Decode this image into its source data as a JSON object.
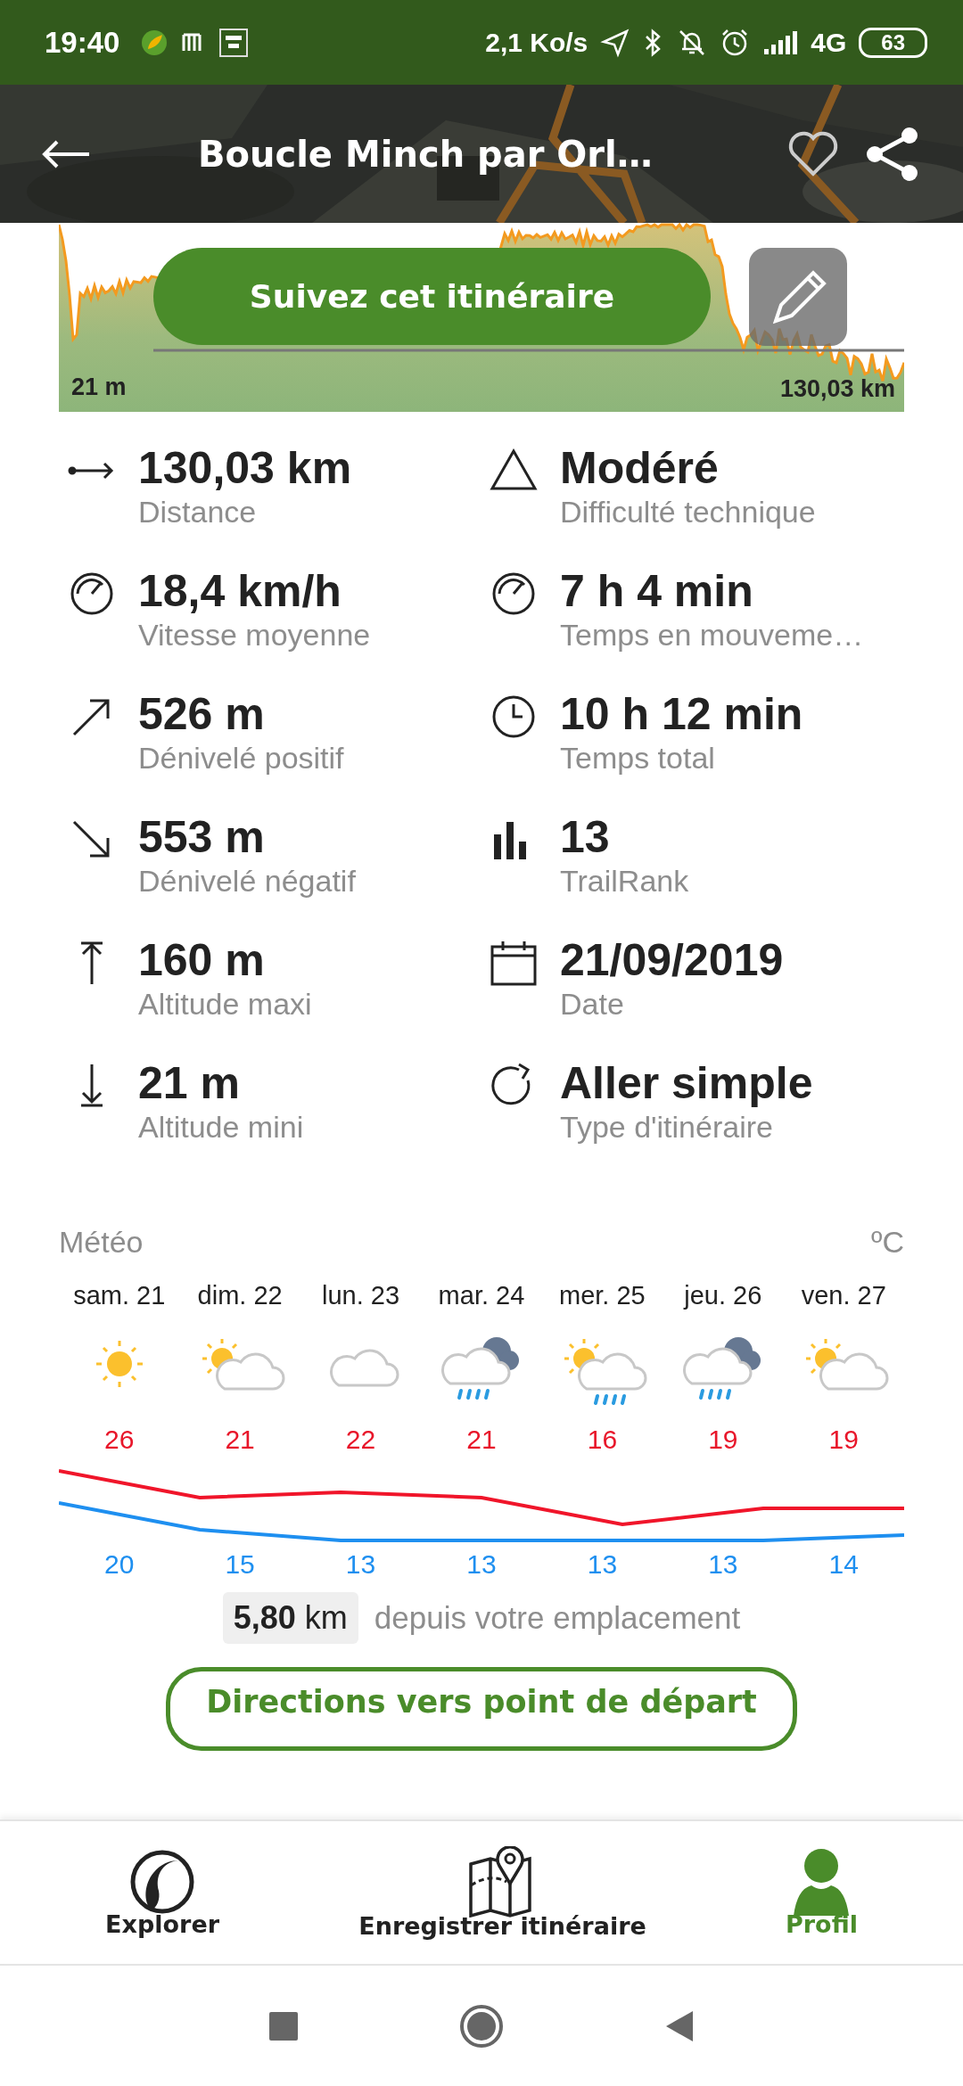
{
  "status_bar": {
    "time": "19:40",
    "speed": "2,1 Ko/s",
    "network": "4G",
    "battery": "63"
  },
  "header": {
    "title": "Boucle Minch par Orl…"
  },
  "profile": {
    "min_label": "21 m",
    "length_label": "130,03 km",
    "follow_button": "Suivez cet itinéraire"
  },
  "stats": [
    {
      "kind": "distance",
      "value": "130,03 km",
      "label": "Distance"
    },
    {
      "kind": "difficulty",
      "value": "Modéré",
      "label": "Difficulté technique"
    },
    {
      "kind": "speed",
      "value": "18,4 km/h",
      "label": "Vitesse moyenne"
    },
    {
      "kind": "moving",
      "value": "7 h 4 min",
      "label": "Temps en mouveme…"
    },
    {
      "kind": "up",
      "value": "526 m",
      "label": "Dénivelé positif"
    },
    {
      "kind": "clock",
      "value": "10 h 12 min",
      "label": "Temps total"
    },
    {
      "kind": "down",
      "value": "553 m",
      "label": "Dénivelé négatif"
    },
    {
      "kind": "rank",
      "value": "13",
      "label": "TrailRank"
    },
    {
      "kind": "max",
      "value": "160 m",
      "label": "Altitude maxi"
    },
    {
      "kind": "date",
      "value": "21/09/2019",
      "label": "Date"
    },
    {
      "kind": "min",
      "value": "21 m",
      "label": "Altitude mini"
    },
    {
      "kind": "loop",
      "value": "Aller simple",
      "label": "Type d'itinéraire"
    }
  ],
  "weather": {
    "title": "Météo",
    "unit": "ºC",
    "days": [
      {
        "day": "sam. 21",
        "kind": "sun",
        "high": "26",
        "low": "20"
      },
      {
        "day": "dim. 22",
        "kind": "sun-cloud",
        "high": "21",
        "low": "15"
      },
      {
        "day": "lun. 23",
        "kind": "cloud",
        "high": "22",
        "low": "13"
      },
      {
        "day": "mar. 24",
        "kind": "storm-rain",
        "high": "21",
        "low": "13"
      },
      {
        "day": "mer. 25",
        "kind": "sun-rain",
        "high": "16",
        "low": "13"
      },
      {
        "day": "jeu. 26",
        "kind": "storm-rain",
        "high": "19",
        "low": "13"
      },
      {
        "day": "ven. 27",
        "kind": "sun-cloud",
        "high": "19",
        "low": "14"
      }
    ]
  },
  "distance": {
    "value": "**5,80** km",
    "label": "depuis votre emplacement"
  },
  "directions_button": "Directions vers point de départ",
  "bottom_nav": [
    {
      "kind": "explore",
      "label": "Explorer",
      "selected": false
    },
    {
      "kind": "record",
      "label": "Enregistrer itinéraire",
      "selected": false
    },
    {
      "kind": "profile",
      "label": "Profil",
      "selected": true
    }
  ]
}
